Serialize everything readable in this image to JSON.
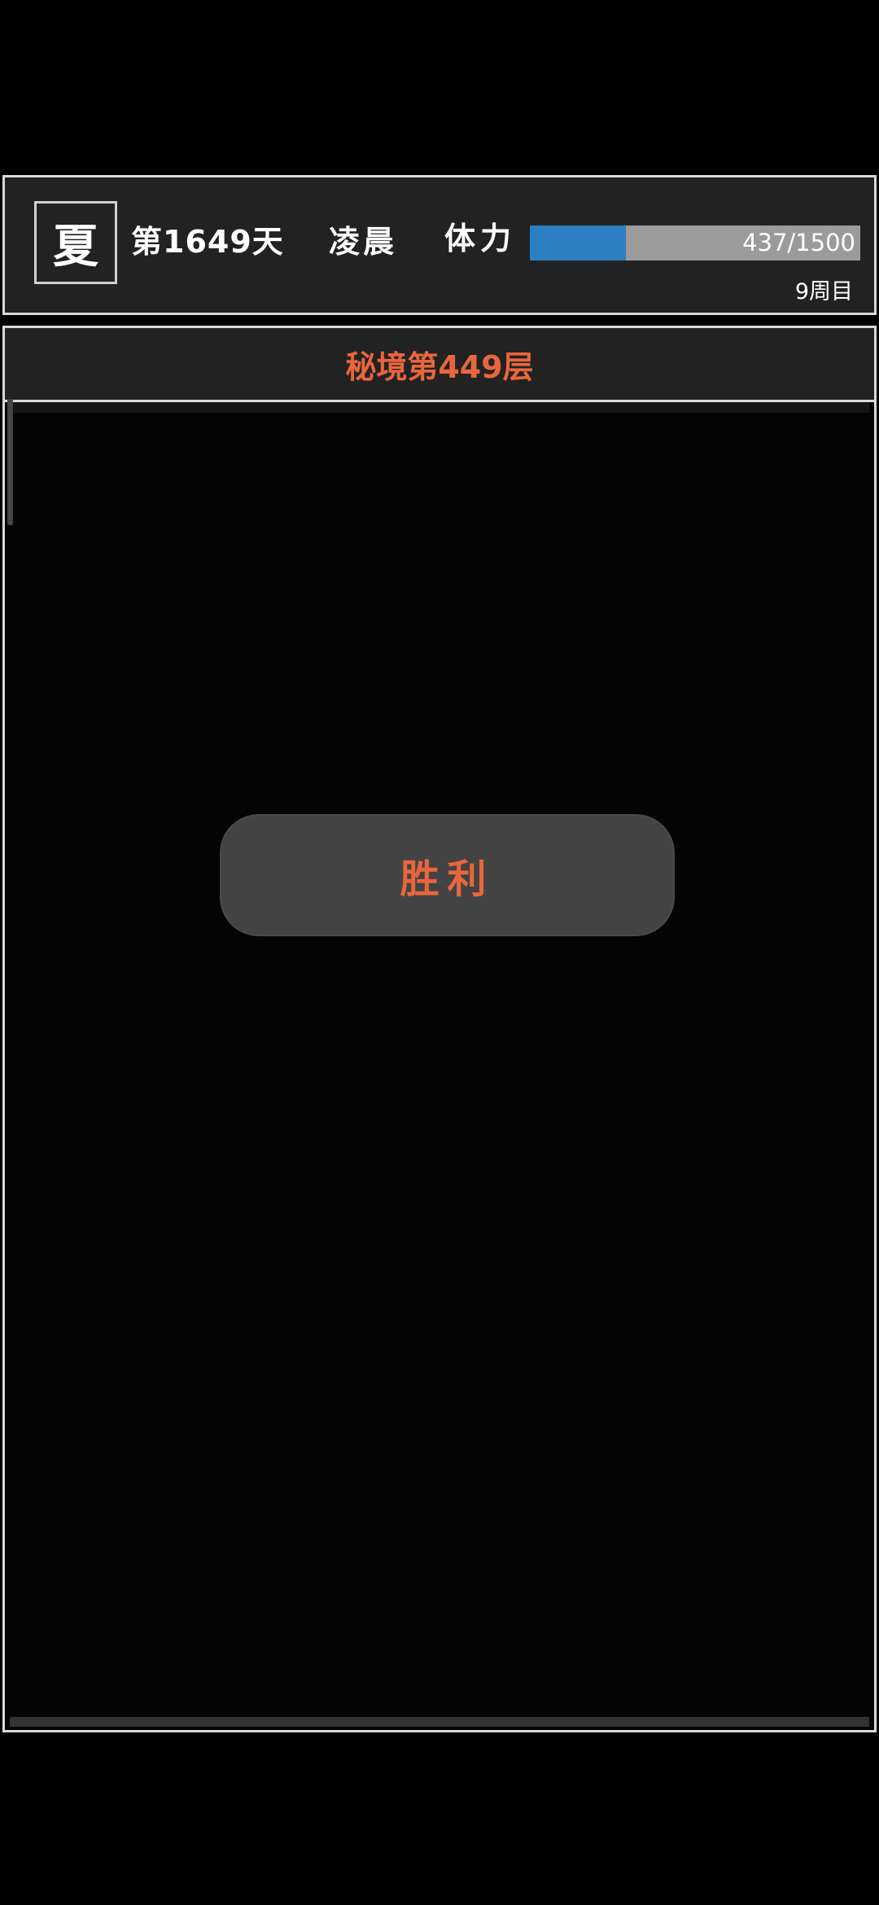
{
  "header": {
    "season": "夏",
    "day": "第1649天",
    "time_of_day": "凌晨",
    "stamina_label": "体力",
    "stamina_current": 437,
    "stamina_max": 1500,
    "stamina_text": "437/1500",
    "cycle": "9周目"
  },
  "dungeon": {
    "title": "秘境第449层"
  },
  "result": {
    "label": "胜利"
  },
  "colors": {
    "accent": "#e9663d",
    "stamina_fill": "#2b7fc2",
    "stamina_track": "#9b9b9b",
    "panel_bg": "#222222",
    "border": "#d9d9d9"
  }
}
